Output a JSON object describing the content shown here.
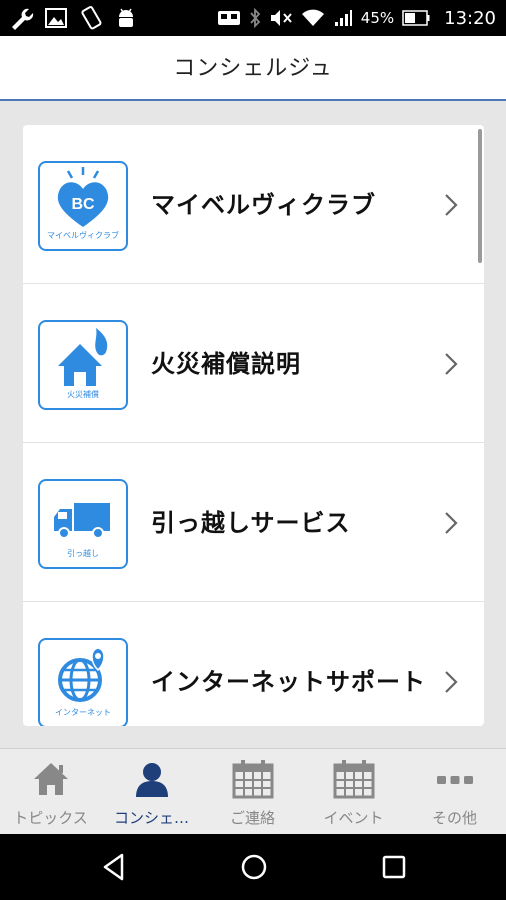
{
  "status_bar": {
    "battery": "45%",
    "time": "13:20"
  },
  "header": {
    "title": "コンシェルジュ"
  },
  "menu": {
    "items": [
      {
        "label": "マイベルヴィクラブ",
        "icon": "heart-bc-icon",
        "icon_text": "BC",
        "icon_caption": "マイベルヴィクラブ"
      },
      {
        "label": "火災補償説明",
        "icon": "house-fire-icon",
        "icon_caption": "火災補償"
      },
      {
        "label": "引っ越しサービス",
        "icon": "truck-icon",
        "icon_caption": "引っ越し"
      },
      {
        "label": "インターネットサポート",
        "icon": "globe-pin-icon",
        "icon_caption": "インターネット"
      }
    ]
  },
  "tabs": [
    {
      "label": "トピックス",
      "icon": "home-icon",
      "active": false
    },
    {
      "label": "コンシェ…",
      "icon": "person-icon",
      "active": true
    },
    {
      "label": "ご連絡",
      "icon": "calendar-icon",
      "active": false
    },
    {
      "label": "イベント",
      "icon": "calendar-icon",
      "active": false
    },
    {
      "label": "その他",
      "icon": "more-dots-icon",
      "active": false
    }
  ],
  "colors": {
    "accent": "#2f8be0",
    "header_border": "#4a77b5",
    "active_tab": "#1f3f7a",
    "inactive_tab": "#888888"
  }
}
